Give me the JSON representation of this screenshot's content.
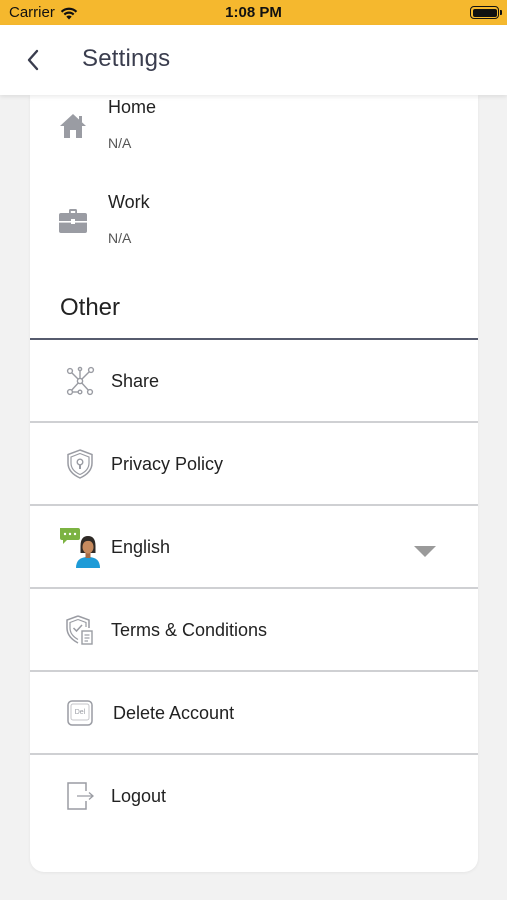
{
  "status_bar": {
    "carrier": "Carrier",
    "time": "1:08 PM",
    "wifi_icon": "wifi-icon",
    "battery_icon": "battery-icon"
  },
  "nav": {
    "title": "Settings",
    "back_icon": "chevron-left-icon"
  },
  "addresses": [
    {
      "label": "Home",
      "value": "N/A",
      "icon": "home-icon"
    },
    {
      "label": "Work",
      "value": "N/A",
      "icon": "briefcase-icon"
    }
  ],
  "other": {
    "title": "Other",
    "items": [
      {
        "label": "Share",
        "icon": "share-network-icon"
      },
      {
        "label": "Privacy Policy",
        "icon": "shield-lock-icon"
      },
      {
        "label": "English",
        "icon": "language-chat-person-icon",
        "dropdown_icon": "caret-down-icon"
      },
      {
        "label": "Terms & Conditions",
        "icon": "shield-document-icon"
      },
      {
        "label": "Delete Account",
        "icon": "delete-key-icon",
        "icon_text": "Del"
      },
      {
        "label": "Logout",
        "icon": "logout-icon"
      }
    ]
  },
  "colors": {
    "status_bar": "#f5b82e",
    "title_text": "#3a3d4e",
    "divider": "#cfd0d3",
    "section_rule": "#565b6d",
    "icon_gray": "#9a9ca3",
    "chat_green": "#7cb342",
    "avatar_blue": "#1e9bd7"
  }
}
